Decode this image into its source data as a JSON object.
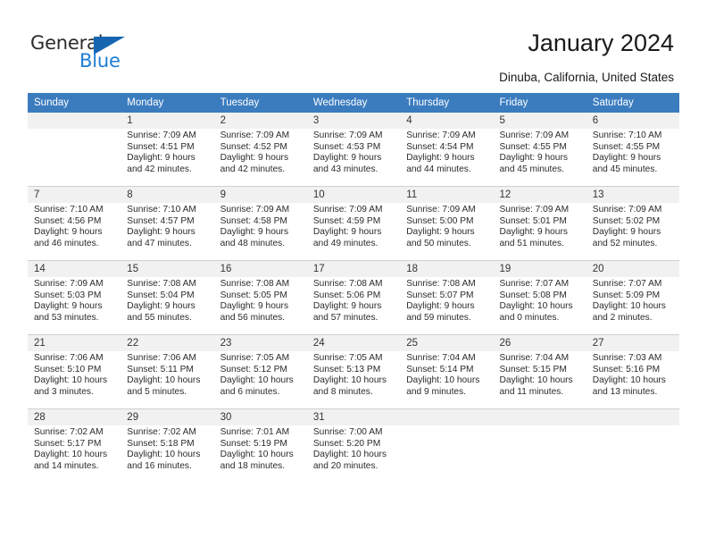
{
  "brand": {
    "name_part1": "General",
    "name_part2": "Blue",
    "triangle_icon": "triangle-icon",
    "accent_color": "#1c7ed6",
    "header_color": "#3b7cbf"
  },
  "header": {
    "title": "January 2024",
    "subtitle": "Dinuba, California, United States"
  },
  "calendar": {
    "weekday_headers": [
      "Sunday",
      "Monday",
      "Tuesday",
      "Wednesday",
      "Thursday",
      "Friday",
      "Saturday"
    ],
    "weeks": [
      {
        "days": [
          {
            "number": "",
            "sunrise": "",
            "sunset": "",
            "daylight_line1": "",
            "daylight_line2": ""
          },
          {
            "number": "1",
            "sunrise": "Sunrise: 7:09 AM",
            "sunset": "Sunset: 4:51 PM",
            "daylight_line1": "Daylight: 9 hours",
            "daylight_line2": "and 42 minutes."
          },
          {
            "number": "2",
            "sunrise": "Sunrise: 7:09 AM",
            "sunset": "Sunset: 4:52 PM",
            "daylight_line1": "Daylight: 9 hours",
            "daylight_line2": "and 42 minutes."
          },
          {
            "number": "3",
            "sunrise": "Sunrise: 7:09 AM",
            "sunset": "Sunset: 4:53 PM",
            "daylight_line1": "Daylight: 9 hours",
            "daylight_line2": "and 43 minutes."
          },
          {
            "number": "4",
            "sunrise": "Sunrise: 7:09 AM",
            "sunset": "Sunset: 4:54 PM",
            "daylight_line1": "Daylight: 9 hours",
            "daylight_line2": "and 44 minutes."
          },
          {
            "number": "5",
            "sunrise": "Sunrise: 7:09 AM",
            "sunset": "Sunset: 4:55 PM",
            "daylight_line1": "Daylight: 9 hours",
            "daylight_line2": "and 45 minutes."
          },
          {
            "number": "6",
            "sunrise": "Sunrise: 7:10 AM",
            "sunset": "Sunset: 4:55 PM",
            "daylight_line1": "Daylight: 9 hours",
            "daylight_line2": "and 45 minutes."
          }
        ]
      },
      {
        "days": [
          {
            "number": "7",
            "sunrise": "Sunrise: 7:10 AM",
            "sunset": "Sunset: 4:56 PM",
            "daylight_line1": "Daylight: 9 hours",
            "daylight_line2": "and 46 minutes."
          },
          {
            "number": "8",
            "sunrise": "Sunrise: 7:10 AM",
            "sunset": "Sunset: 4:57 PM",
            "daylight_line1": "Daylight: 9 hours",
            "daylight_line2": "and 47 minutes."
          },
          {
            "number": "9",
            "sunrise": "Sunrise: 7:09 AM",
            "sunset": "Sunset: 4:58 PM",
            "daylight_line1": "Daylight: 9 hours",
            "daylight_line2": "and 48 minutes."
          },
          {
            "number": "10",
            "sunrise": "Sunrise: 7:09 AM",
            "sunset": "Sunset: 4:59 PM",
            "daylight_line1": "Daylight: 9 hours",
            "daylight_line2": "and 49 minutes."
          },
          {
            "number": "11",
            "sunrise": "Sunrise: 7:09 AM",
            "sunset": "Sunset: 5:00 PM",
            "daylight_line1": "Daylight: 9 hours",
            "daylight_line2": "and 50 minutes."
          },
          {
            "number": "12",
            "sunrise": "Sunrise: 7:09 AM",
            "sunset": "Sunset: 5:01 PM",
            "daylight_line1": "Daylight: 9 hours",
            "daylight_line2": "and 51 minutes."
          },
          {
            "number": "13",
            "sunrise": "Sunrise: 7:09 AM",
            "sunset": "Sunset: 5:02 PM",
            "daylight_line1": "Daylight: 9 hours",
            "daylight_line2": "and 52 minutes."
          }
        ]
      },
      {
        "days": [
          {
            "number": "14",
            "sunrise": "Sunrise: 7:09 AM",
            "sunset": "Sunset: 5:03 PM",
            "daylight_line1": "Daylight: 9 hours",
            "daylight_line2": "and 53 minutes."
          },
          {
            "number": "15",
            "sunrise": "Sunrise: 7:08 AM",
            "sunset": "Sunset: 5:04 PM",
            "daylight_line1": "Daylight: 9 hours",
            "daylight_line2": "and 55 minutes."
          },
          {
            "number": "16",
            "sunrise": "Sunrise: 7:08 AM",
            "sunset": "Sunset: 5:05 PM",
            "daylight_line1": "Daylight: 9 hours",
            "daylight_line2": "and 56 minutes."
          },
          {
            "number": "17",
            "sunrise": "Sunrise: 7:08 AM",
            "sunset": "Sunset: 5:06 PM",
            "daylight_line1": "Daylight: 9 hours",
            "daylight_line2": "and 57 minutes."
          },
          {
            "number": "18",
            "sunrise": "Sunrise: 7:08 AM",
            "sunset": "Sunset: 5:07 PM",
            "daylight_line1": "Daylight: 9 hours",
            "daylight_line2": "and 59 minutes."
          },
          {
            "number": "19",
            "sunrise": "Sunrise: 7:07 AM",
            "sunset": "Sunset: 5:08 PM",
            "daylight_line1": "Daylight: 10 hours",
            "daylight_line2": "and 0 minutes."
          },
          {
            "number": "20",
            "sunrise": "Sunrise: 7:07 AM",
            "sunset": "Sunset: 5:09 PM",
            "daylight_line1": "Daylight: 10 hours",
            "daylight_line2": "and 2 minutes."
          }
        ]
      },
      {
        "days": [
          {
            "number": "21",
            "sunrise": "Sunrise: 7:06 AM",
            "sunset": "Sunset: 5:10 PM",
            "daylight_line1": "Daylight: 10 hours",
            "daylight_line2": "and 3 minutes."
          },
          {
            "number": "22",
            "sunrise": "Sunrise: 7:06 AM",
            "sunset": "Sunset: 5:11 PM",
            "daylight_line1": "Daylight: 10 hours",
            "daylight_line2": "and 5 minutes."
          },
          {
            "number": "23",
            "sunrise": "Sunrise: 7:05 AM",
            "sunset": "Sunset: 5:12 PM",
            "daylight_line1": "Daylight: 10 hours",
            "daylight_line2": "and 6 minutes."
          },
          {
            "number": "24",
            "sunrise": "Sunrise: 7:05 AM",
            "sunset": "Sunset: 5:13 PM",
            "daylight_line1": "Daylight: 10 hours",
            "daylight_line2": "and 8 minutes."
          },
          {
            "number": "25",
            "sunrise": "Sunrise: 7:04 AM",
            "sunset": "Sunset: 5:14 PM",
            "daylight_line1": "Daylight: 10 hours",
            "daylight_line2": "and 9 minutes."
          },
          {
            "number": "26",
            "sunrise": "Sunrise: 7:04 AM",
            "sunset": "Sunset: 5:15 PM",
            "daylight_line1": "Daylight: 10 hours",
            "daylight_line2": "and 11 minutes."
          },
          {
            "number": "27",
            "sunrise": "Sunrise: 7:03 AM",
            "sunset": "Sunset: 5:16 PM",
            "daylight_line1": "Daylight: 10 hours",
            "daylight_line2": "and 13 minutes."
          }
        ]
      },
      {
        "days": [
          {
            "number": "28",
            "sunrise": "Sunrise: 7:02 AM",
            "sunset": "Sunset: 5:17 PM",
            "daylight_line1": "Daylight: 10 hours",
            "daylight_line2": "and 14 minutes."
          },
          {
            "number": "29",
            "sunrise": "Sunrise: 7:02 AM",
            "sunset": "Sunset: 5:18 PM",
            "daylight_line1": "Daylight: 10 hours",
            "daylight_line2": "and 16 minutes."
          },
          {
            "number": "30",
            "sunrise": "Sunrise: 7:01 AM",
            "sunset": "Sunset: 5:19 PM",
            "daylight_line1": "Daylight: 10 hours",
            "daylight_line2": "and 18 minutes."
          },
          {
            "number": "31",
            "sunrise": "Sunrise: 7:00 AM",
            "sunset": "Sunset: 5:20 PM",
            "daylight_line1": "Daylight: 10 hours",
            "daylight_line2": "and 20 minutes."
          },
          {
            "number": "",
            "sunrise": "",
            "sunset": "",
            "daylight_line1": "",
            "daylight_line2": ""
          },
          {
            "number": "",
            "sunrise": "",
            "sunset": "",
            "daylight_line1": "",
            "daylight_line2": ""
          },
          {
            "number": "",
            "sunrise": "",
            "sunset": "",
            "daylight_line1": "",
            "daylight_line2": ""
          }
        ]
      }
    ]
  }
}
